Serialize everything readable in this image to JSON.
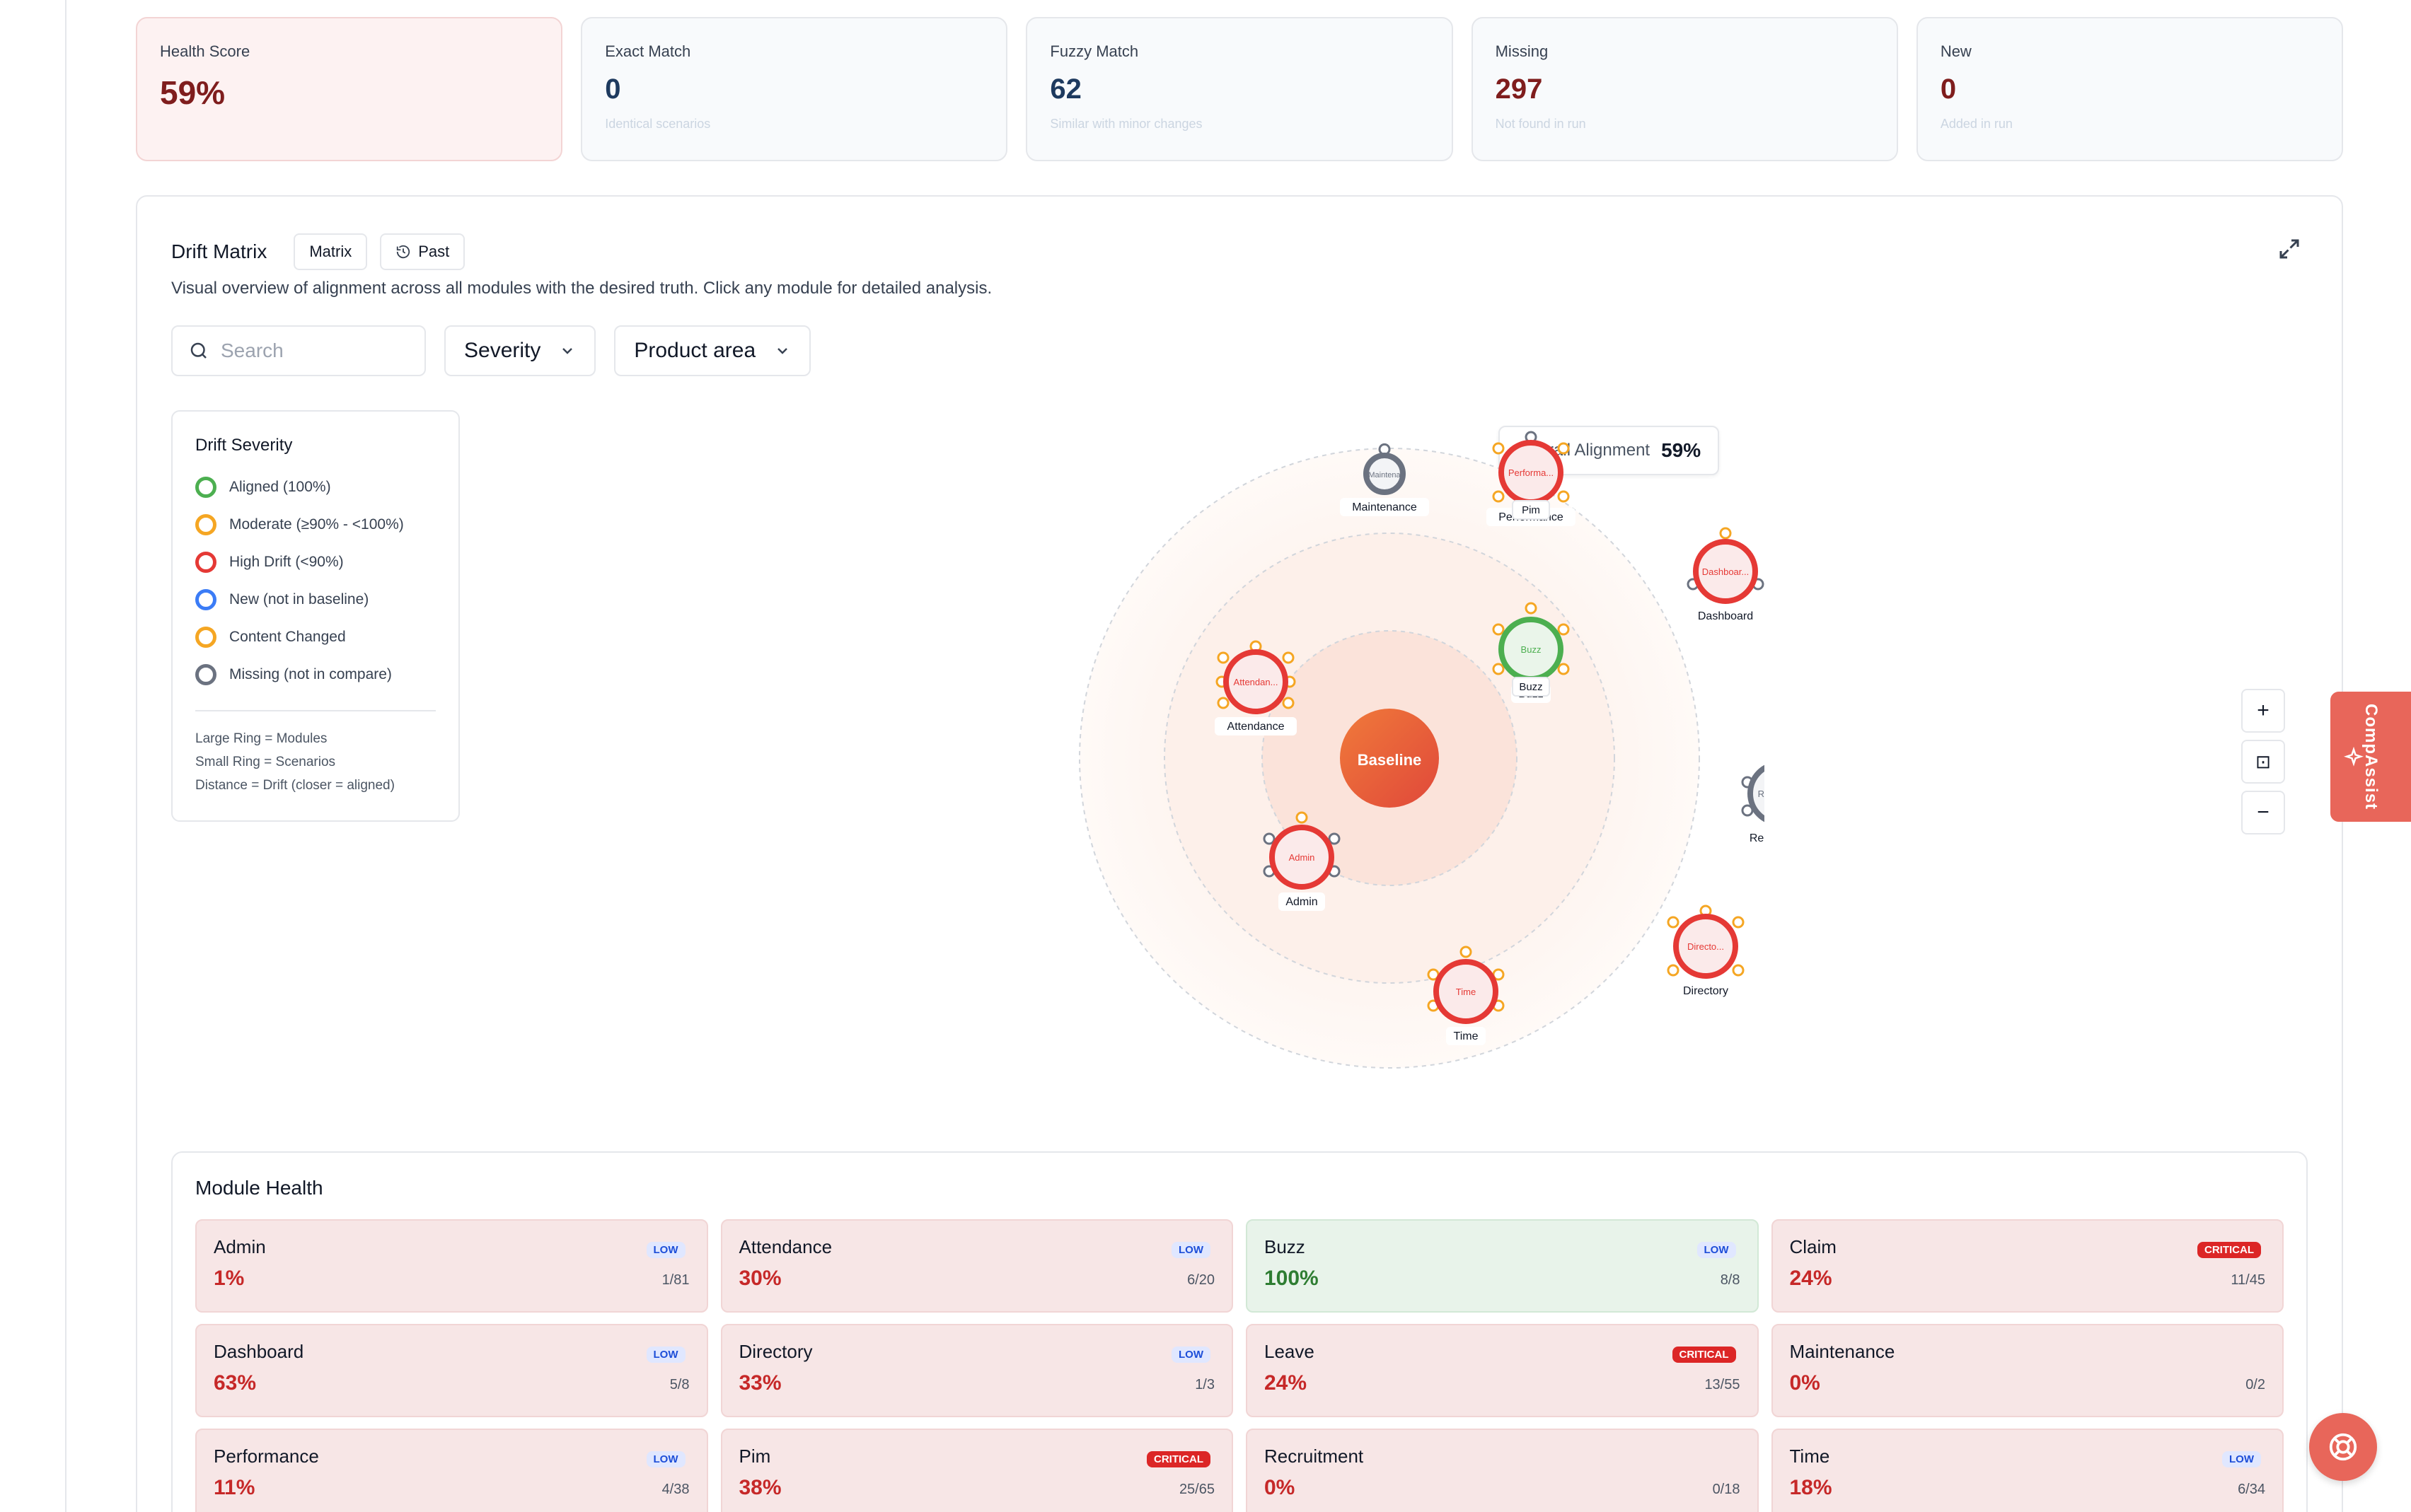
{
  "stats": [
    {
      "label": "Health Score",
      "value": "59%",
      "sub": ""
    },
    {
      "label": "Exact Match",
      "value": "0",
      "sub": "Identical scenarios"
    },
    {
      "label": "Fuzzy Match",
      "value": "62",
      "sub": "Similar with minor changes"
    },
    {
      "label": "Missing",
      "value": "297",
      "sub": "Not found in run"
    },
    {
      "label": "New",
      "value": "0",
      "sub": "Added in run"
    }
  ],
  "drift": {
    "title": "Drift Matrix",
    "matrix_label": "Matrix",
    "past_label": "Past",
    "description": "Visual overview of alignment across all modules with the desired truth. Click any module for detailed analysis.",
    "search_placeholder": "Search",
    "severity_label": "Severity",
    "product_area_label": "Product area",
    "overall_label": "Overall Alignment",
    "overall_value": "59%",
    "center_label": "Baseline",
    "zoom_in": "+",
    "zoom_fit": "⊡",
    "zoom_out": "−"
  },
  "legend": {
    "title": "Drift Severity",
    "items": [
      {
        "label": "Aligned (100%)",
        "color": "#4caf50"
      },
      {
        "label": "Moderate (≥90% - <100%)",
        "color": "#f5a623"
      },
      {
        "label": "High Drift (<90%)",
        "color": "#e53935"
      },
      {
        "label": "New (not in baseline)",
        "color": "#3b7cf6"
      },
      {
        "label": "Content Changed",
        "color": "#f5a623"
      },
      {
        "label": "Missing (not in compare)",
        "color": "#6b7280"
      }
    ],
    "notes": [
      "Large Ring = Modules",
      "Small Ring = Scenarios",
      "Distance = Drift (closer = aligned)"
    ]
  },
  "nodes": [
    {
      "label": "Maintenance",
      "inner": "Maintena",
      "color": "#6b7280"
    },
    {
      "label": "Performance",
      "inner": "Performa...",
      "color": "#e53935",
      "tag": "Pim"
    },
    {
      "label": "Dashboard",
      "inner": "Dashboar...",
      "color": "#e53935"
    },
    {
      "label": "Buzz",
      "inner": "Buzz",
      "color": "#4caf50",
      "tag": "Buzz"
    },
    {
      "label": "Attendance",
      "inner": "Attendan...",
      "color": "#e53935"
    },
    {
      "label": "Recruitment",
      "inner": "Recruitm...",
      "color": "#6b7280"
    },
    {
      "label": "Admin",
      "inner": "Admin",
      "color": "#e53935"
    },
    {
      "label": "Directory",
      "inner": "Directo...",
      "color": "#e53935"
    },
    {
      "label": "Time",
      "inner": "Time",
      "color": "#e53935"
    }
  ],
  "compassist": "CompAssist",
  "module_health": {
    "title": "Module Health",
    "modules": [
      {
        "name": "Admin",
        "pct": "1%",
        "badge": "LOW",
        "count": "1/81"
      },
      {
        "name": "Attendance",
        "pct": "30%",
        "badge": "LOW",
        "count": "6/20"
      },
      {
        "name": "Buzz",
        "pct": "100%",
        "badge": "LOW",
        "count": "8/8"
      },
      {
        "name": "Claim",
        "pct": "24%",
        "badge": "CRITICAL",
        "count": "11/45"
      },
      {
        "name": "Dashboard",
        "pct": "63%",
        "badge": "LOW",
        "count": "5/8"
      },
      {
        "name": "Directory",
        "pct": "33%",
        "badge": "LOW",
        "count": "1/3"
      },
      {
        "name": "Leave",
        "pct": "24%",
        "badge": "CRITICAL",
        "count": "13/55"
      },
      {
        "name": "Maintenance",
        "pct": "0%",
        "badge": "",
        "count": "0/2"
      },
      {
        "name": "Performance",
        "pct": "11%",
        "badge": "LOW",
        "count": "4/38"
      },
      {
        "name": "Pim",
        "pct": "38%",
        "badge": "CRITICAL",
        "count": "25/65"
      },
      {
        "name": "Recruitment",
        "pct": "0%",
        "badge": "",
        "count": "0/18"
      },
      {
        "name": "Time",
        "pct": "18%",
        "badge": "LOW",
        "count": "6/34"
      }
    ]
  }
}
